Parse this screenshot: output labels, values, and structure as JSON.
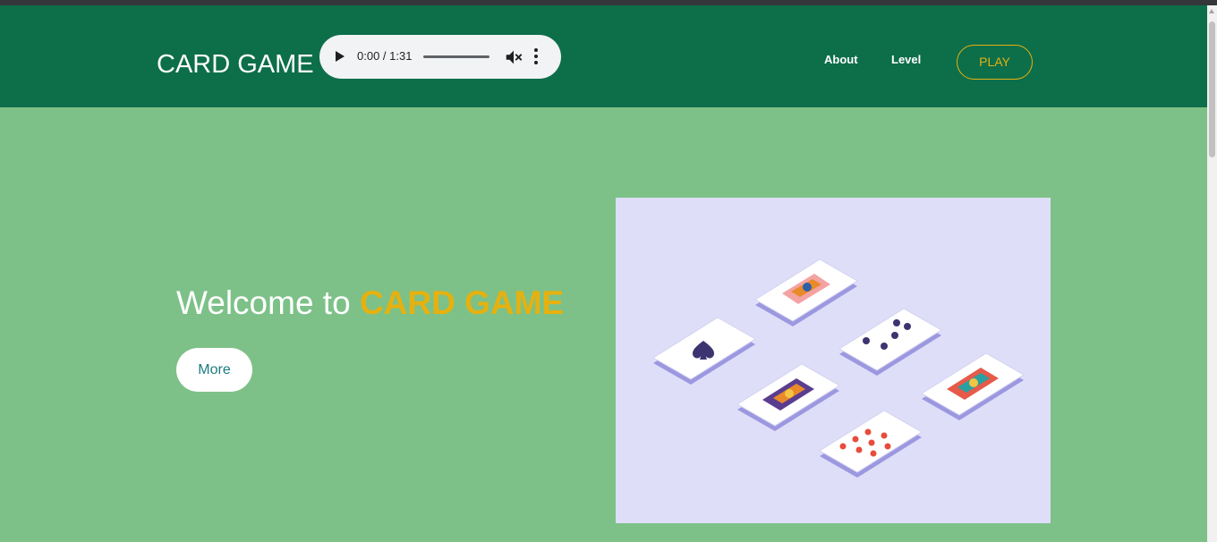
{
  "header": {
    "brand": "CARD GAME",
    "audio_time": "0:00 / 1:31",
    "nav": {
      "about": "About",
      "level": "Level",
      "play": "PLAY"
    }
  },
  "hero": {
    "title_prefix": "Welcome to ",
    "title_highlight": "CARD GAME",
    "more_label": "More"
  },
  "colors": {
    "navbar": "#0d6e4a",
    "background": "#7dc188",
    "accent": "#e6b10f",
    "illustration_bg": "#dedef9"
  },
  "icons": [
    "play-icon",
    "mute-icon",
    "more-vert-icon",
    "spade-icon",
    "club-icon",
    "heart-icon"
  ]
}
